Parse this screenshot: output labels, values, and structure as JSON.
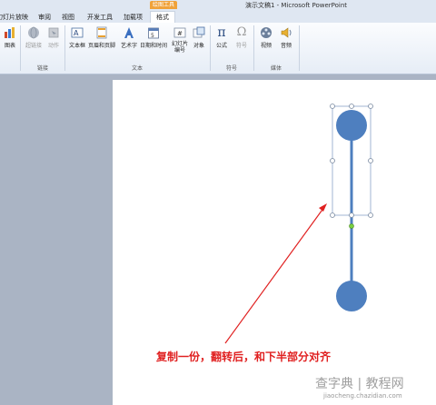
{
  "window": {
    "title": "演示文稿1 - Microsoft PowerPoint"
  },
  "context_tab": {
    "header": "绘图工具",
    "label": "格式"
  },
  "tabs": [
    "幻灯片放映",
    "审阅",
    "视图",
    "开发工具",
    "加载项"
  ],
  "ribbon": {
    "buttons": {
      "chart": "图表",
      "hyperlink": "超链接",
      "action": "动作",
      "textbox": "文本框",
      "header_footer": "页眉和页脚",
      "wordart": "艺术字",
      "datetime": "日期和时间",
      "slide_number": "幻灯片\n编号",
      "object": "对象",
      "equation": "公式",
      "symbol": "符号",
      "video": "视频",
      "audio": "音频"
    },
    "groups": {
      "links": "链接",
      "text": "文本",
      "symbols": "符号",
      "media": "媒体"
    }
  },
  "slide": {
    "caption": "复制一份，翻转后，和下半部分对齐"
  },
  "watermark": {
    "main": "查字典 | 教程网",
    "url": "jiaocheng.chazidian.com"
  },
  "colors": {
    "shape_fill": "#4e7fbf",
    "arrow": "#e02020",
    "caption": "#e02020"
  }
}
